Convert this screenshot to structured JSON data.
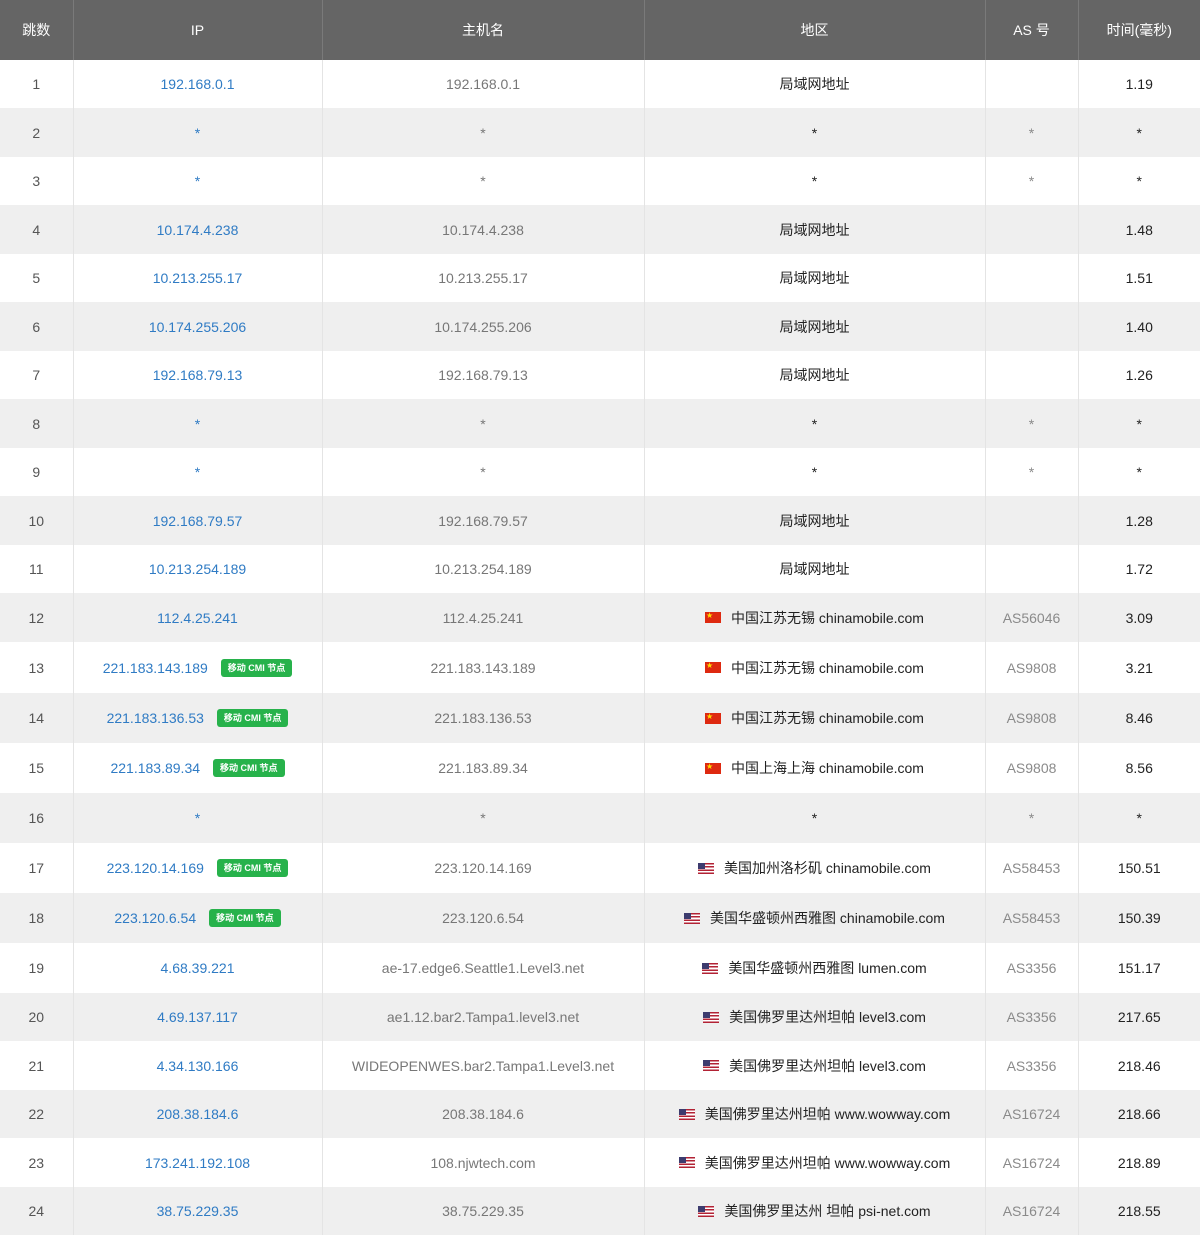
{
  "columns": [
    "跳数",
    "IP",
    "主机名",
    "地区",
    "AS 号",
    "时间(毫秒)"
  ],
  "colors": {
    "header_bg": "#656565",
    "ip_link": "#2f7bc4",
    "badge_bg": "#27b24b",
    "row_alt": "#efefef"
  },
  "rows": [
    {
      "hop": "1",
      "ip": "192.168.0.1",
      "badge": "",
      "host": "192.168.0.1",
      "flag": "",
      "region": "局域网地址",
      "as": "",
      "time": "1.19"
    },
    {
      "hop": "2",
      "ip": "*",
      "badge": "",
      "host": "*",
      "flag": "",
      "region": "*",
      "as": "*",
      "time": "*"
    },
    {
      "hop": "3",
      "ip": "*",
      "badge": "",
      "host": "*",
      "flag": "",
      "region": "*",
      "as": "*",
      "time": "*"
    },
    {
      "hop": "4",
      "ip": "10.174.4.238",
      "badge": "",
      "host": "10.174.4.238",
      "flag": "",
      "region": "局域网地址",
      "as": "",
      "time": "1.48"
    },
    {
      "hop": "5",
      "ip": "10.213.255.17",
      "badge": "",
      "host": "10.213.255.17",
      "flag": "",
      "region": "局域网地址",
      "as": "",
      "time": "1.51"
    },
    {
      "hop": "6",
      "ip": "10.174.255.206",
      "badge": "",
      "host": "10.174.255.206",
      "flag": "",
      "region": "局域网地址",
      "as": "",
      "time": "1.40"
    },
    {
      "hop": "7",
      "ip": "192.168.79.13",
      "badge": "",
      "host": "192.168.79.13",
      "flag": "",
      "region": "局域网地址",
      "as": "",
      "time": "1.26"
    },
    {
      "hop": "8",
      "ip": "*",
      "badge": "",
      "host": "*",
      "flag": "",
      "region": "*",
      "as": "*",
      "time": "*"
    },
    {
      "hop": "9",
      "ip": "*",
      "badge": "",
      "host": "*",
      "flag": "",
      "region": "*",
      "as": "*",
      "time": "*"
    },
    {
      "hop": "10",
      "ip": "192.168.79.57",
      "badge": "",
      "host": "192.168.79.57",
      "flag": "",
      "region": "局域网地址",
      "as": "",
      "time": "1.28"
    },
    {
      "hop": "11",
      "ip": "10.213.254.189",
      "badge": "",
      "host": "10.213.254.189",
      "flag": "",
      "region": "局域网地址",
      "as": "",
      "time": "1.72"
    },
    {
      "hop": "12",
      "ip": "112.4.25.241",
      "badge": "",
      "host": "112.4.25.241",
      "flag": "cn",
      "region": "中国江苏无锡 chinamobile.com",
      "as": "AS56046",
      "time": "3.09"
    },
    {
      "hop": "13",
      "ip": "221.183.143.189",
      "badge": "移动 CMI 节点",
      "host": "221.183.143.189",
      "flag": "cn",
      "region": "中国江苏无锡 chinamobile.com",
      "as": "AS9808",
      "time": "3.21"
    },
    {
      "hop": "14",
      "ip": "221.183.136.53",
      "badge": "移动 CMI 节点",
      "host": "221.183.136.53",
      "flag": "cn",
      "region": "中国江苏无锡 chinamobile.com",
      "as": "AS9808",
      "time": "8.46"
    },
    {
      "hop": "15",
      "ip": "221.183.89.34",
      "badge": "移动 CMI 节点",
      "host": "221.183.89.34",
      "flag": "cn",
      "region": "中国上海上海 chinamobile.com",
      "as": "AS9808",
      "time": "8.56"
    },
    {
      "hop": "16",
      "ip": "*",
      "badge": "",
      "host": "*",
      "flag": "",
      "region": "*",
      "as": "*",
      "time": "*"
    },
    {
      "hop": "17",
      "ip": "223.120.14.169",
      "badge": "移动 CMI 节点",
      "host": "223.120.14.169",
      "flag": "us",
      "region": "美国加州洛杉矶 chinamobile.com",
      "as": "AS58453",
      "time": "150.51"
    },
    {
      "hop": "18",
      "ip": "223.120.6.54",
      "badge": "移动 CMI 节点",
      "host": "223.120.6.54",
      "flag": "us",
      "region": "美国华盛顿州西雅图 chinamobile.com",
      "as": "AS58453",
      "time": "150.39"
    },
    {
      "hop": "19",
      "ip": "4.68.39.221",
      "badge": "",
      "host": "ae-17.edge6.Seattle1.Level3.net",
      "flag": "us",
      "region": "美国华盛顿州西雅图 lumen.com",
      "as": "AS3356",
      "time": "151.17"
    },
    {
      "hop": "20",
      "ip": "4.69.137.117",
      "badge": "",
      "host": "ae1.12.bar2.Tampa1.level3.net",
      "flag": "us",
      "region": "美国佛罗里达州坦帕 level3.com",
      "as": "AS3356",
      "time": "217.65"
    },
    {
      "hop": "21",
      "ip": "4.34.130.166",
      "badge": "",
      "host": "WIDEOPENWES.bar2.Tampa1.Level3.net",
      "flag": "us",
      "region": "美国佛罗里达州坦帕 level3.com",
      "as": "AS3356",
      "time": "218.46"
    },
    {
      "hop": "22",
      "ip": "208.38.184.6",
      "badge": "",
      "host": "208.38.184.6",
      "flag": "us",
      "region": "美国佛罗里达州坦帕 www.wowway.com",
      "as": "AS16724",
      "time": "218.66"
    },
    {
      "hop": "23",
      "ip": "173.241.192.108",
      "badge": "",
      "host": "108.njwtech.com",
      "flag": "us",
      "region": "美国佛罗里达州坦帕 www.wowway.com",
      "as": "AS16724",
      "time": "218.89"
    },
    {
      "hop": "24",
      "ip": "38.75.229.35",
      "badge": "",
      "host": "38.75.229.35",
      "flag": "us",
      "region": "美国佛罗里达州 坦帕 psi-net.com",
      "as": "AS16724",
      "time": "218.55"
    }
  ]
}
